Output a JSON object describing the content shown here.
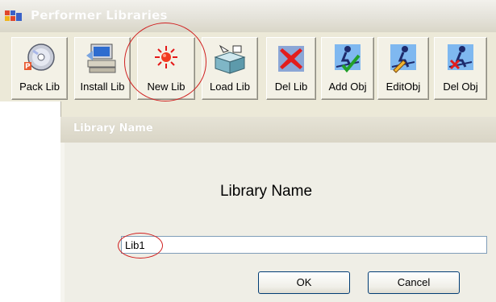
{
  "window": {
    "title": "Performer Libraries"
  },
  "toolbar": {
    "buttons": [
      {
        "label": "Pack Lib",
        "icon": "cd-pack-icon"
      },
      {
        "label": "Install Lib",
        "icon": "computer-install-icon"
      },
      {
        "label": "New Lib",
        "icon": "new-burst-icon"
      },
      {
        "label": "Load Lib",
        "icon": "box-load-icon"
      },
      {
        "label": "Del Lib",
        "icon": "red-x-delete-icon"
      },
      {
        "label": "Add Obj",
        "icon": "skier-add-icon"
      },
      {
        "label": "EditObj",
        "icon": "skier-edit-icon"
      },
      {
        "label": "Del Obj",
        "icon": "skier-delete-icon"
      }
    ]
  },
  "dialog": {
    "title": "Library Name",
    "heading": "Library Name",
    "input_value": "Lib1",
    "ok_label": "OK",
    "cancel_label": "Cancel"
  },
  "colors": {
    "annotation": "#d02020",
    "dialog_background": "#efeee6",
    "input_border": "#7f9db9"
  }
}
